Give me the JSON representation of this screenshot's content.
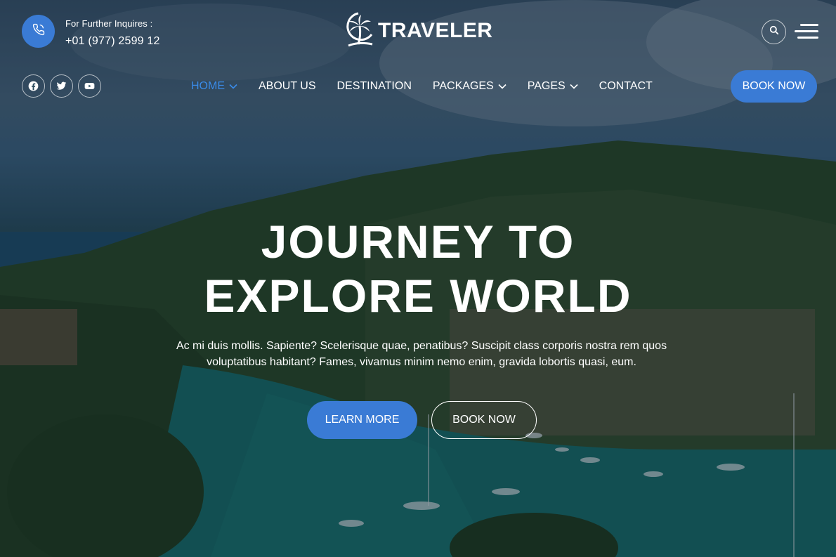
{
  "header": {
    "inquiry_label": "For Further Inquires :",
    "phone": "+01 (977) 2599 12",
    "logo_text": "TRAVELER"
  },
  "social": [
    "facebook-icon",
    "twitter-icon",
    "youtube-icon"
  ],
  "nav": {
    "items": [
      {
        "label": "HOME",
        "has_dropdown": true,
        "active": true
      },
      {
        "label": "ABOUT US",
        "has_dropdown": false
      },
      {
        "label": "DESTINATION",
        "has_dropdown": false
      },
      {
        "label": "PACKAGES",
        "has_dropdown": true
      },
      {
        "label": "PAGES",
        "has_dropdown": true
      },
      {
        "label": "CONTACT",
        "has_dropdown": false
      }
    ],
    "book_label": "BOOK NOW"
  },
  "hero": {
    "headline_line1": "JOURNEY TO",
    "headline_line2": "EXPLORE WORLD",
    "subtext_line1": "Ac mi duis mollis. Sapiente? Scelerisque quae, penatibus? Suscipit class corporis nostra rem quos",
    "subtext_line2": "voluptatibus habitant? Fames, vivamus minim nemo enim, gravida lobortis quasi, eum.",
    "learn_more_label": "LEARN MORE",
    "book_now_label": "BOOK NOW"
  },
  "colors": {
    "accent": "#3a7bd5",
    "active_nav": "#3a8be8",
    "text": "#ffffff"
  }
}
